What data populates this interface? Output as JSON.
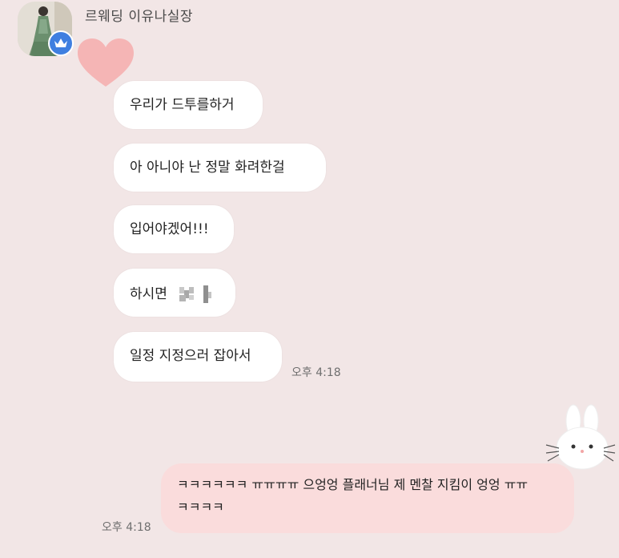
{
  "sender": {
    "name": "르웨딩 이유나실장"
  },
  "incoming_messages": [
    {
      "text": "우리가 드투를하거"
    },
    {
      "text": "아 아니야 난 정말 화려한걸"
    },
    {
      "text": "입어야겠어!!!"
    },
    {
      "text": "하시면"
    },
    {
      "text": "일정 지정으러 잡아서"
    }
  ],
  "incoming_time": "오후 4:18",
  "outgoing_message": {
    "text": "ㅋㅋㅋㅋㅋㅋ ㅠㅠㅠㅠ 으엉엉 플래너님 제 멘찰 지킴이 엉엉 ㅠㅠ ㅋㅋㅋㅋ",
    "time": "오후 4:18"
  },
  "colors": {
    "background": "#f2e6e6",
    "incoming_bubble": "#ffffff",
    "outgoing_bubble": "#fadcdc",
    "heart": "#f5b5b5",
    "badge": "#3f7fe0"
  },
  "icons": {
    "badge": "crown-icon",
    "heart": "heart-sticker",
    "bunny": "bunny-sticker"
  }
}
